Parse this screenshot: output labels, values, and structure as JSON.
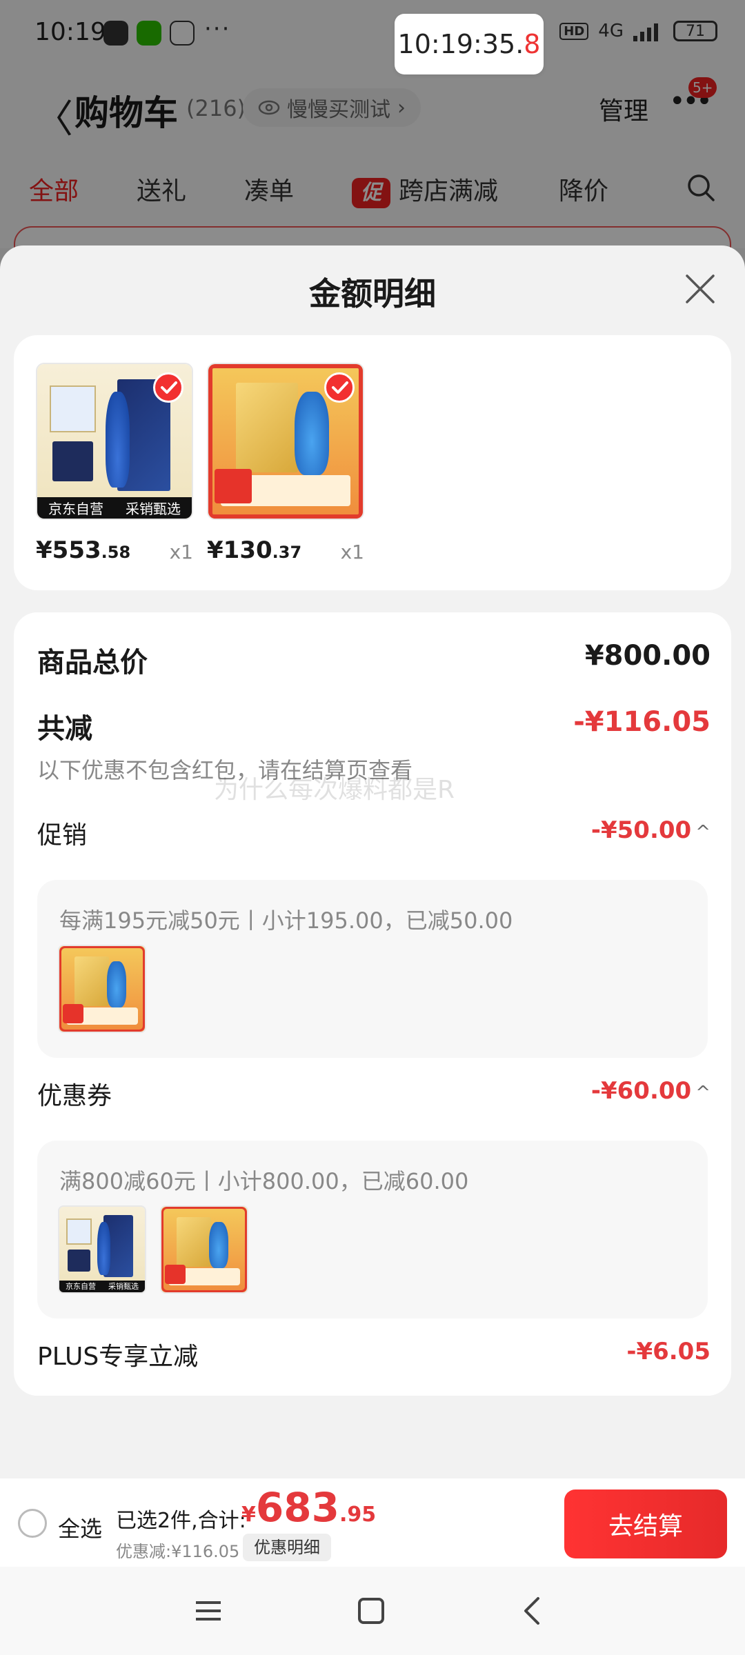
{
  "status_bar": {
    "time": "10:19",
    "more": "···",
    "clock_bubble_main": "10:19:35.",
    "clock_bubble_frac": "8",
    "hd": "HD",
    "network": "4G",
    "battery": "71"
  },
  "nav": {
    "back": "〈",
    "title": "购物车",
    "count": "(216)",
    "chip_text": "慢慢买测试",
    "chip_arrow": "›",
    "manage": "管理",
    "dots": "•••",
    "badge": "5+"
  },
  "tabs": {
    "all": "全部",
    "gift": "送礼",
    "bundle": "凑单",
    "promo_tag": "促",
    "cross_store": "跨店满减",
    "price_drop": "降价"
  },
  "sheet": {
    "title": "金额明细",
    "products": [
      {
        "price_int": "¥553",
        "price_dec": ".58",
        "qty": "x1",
        "strip_left": "京东自营",
        "strip_right": "采销甄选"
      },
      {
        "price_int": "¥130",
        "price_dec": ".37",
        "qty": "x1"
      }
    ],
    "total_label": "商品总价",
    "total_value": "¥800.00",
    "reduce_label": "共减",
    "reduce_value": "-¥116.05",
    "note": "以下优惠不包含红包，请在结算页查看",
    "watermark": "为什么每次爆料都是R",
    "promo_label": "促销",
    "promo_value": "-¥50.00",
    "promo_rule": "每满195元减50元丨小计195.00，已减50.00",
    "coupon_label": "优惠券",
    "coupon_value": "-¥60.00",
    "coupon_rule": "满800减60元丨小计800.00，已减60.00",
    "plus_label": "PLUS专享立减",
    "plus_value": "-¥6.05",
    "caret": "^"
  },
  "bottom_bar": {
    "select_all": "全选",
    "selected_info": "已选2件,合计:",
    "total_yen": "¥",
    "total_int": "683",
    "total_dec": ".95",
    "discount": "优惠减:¥116.05",
    "detail_chip": "优惠明细",
    "checkout": "去结算"
  },
  "colors": {
    "accent_red": "#e4393c",
    "checkout_red": "#f33"
  },
  "icons": [
    "back-arrow-icon",
    "eye-icon",
    "more-dots-icon",
    "search-icon",
    "close-icon",
    "check-icon",
    "menu-icon",
    "home-icon",
    "back-icon"
  ]
}
